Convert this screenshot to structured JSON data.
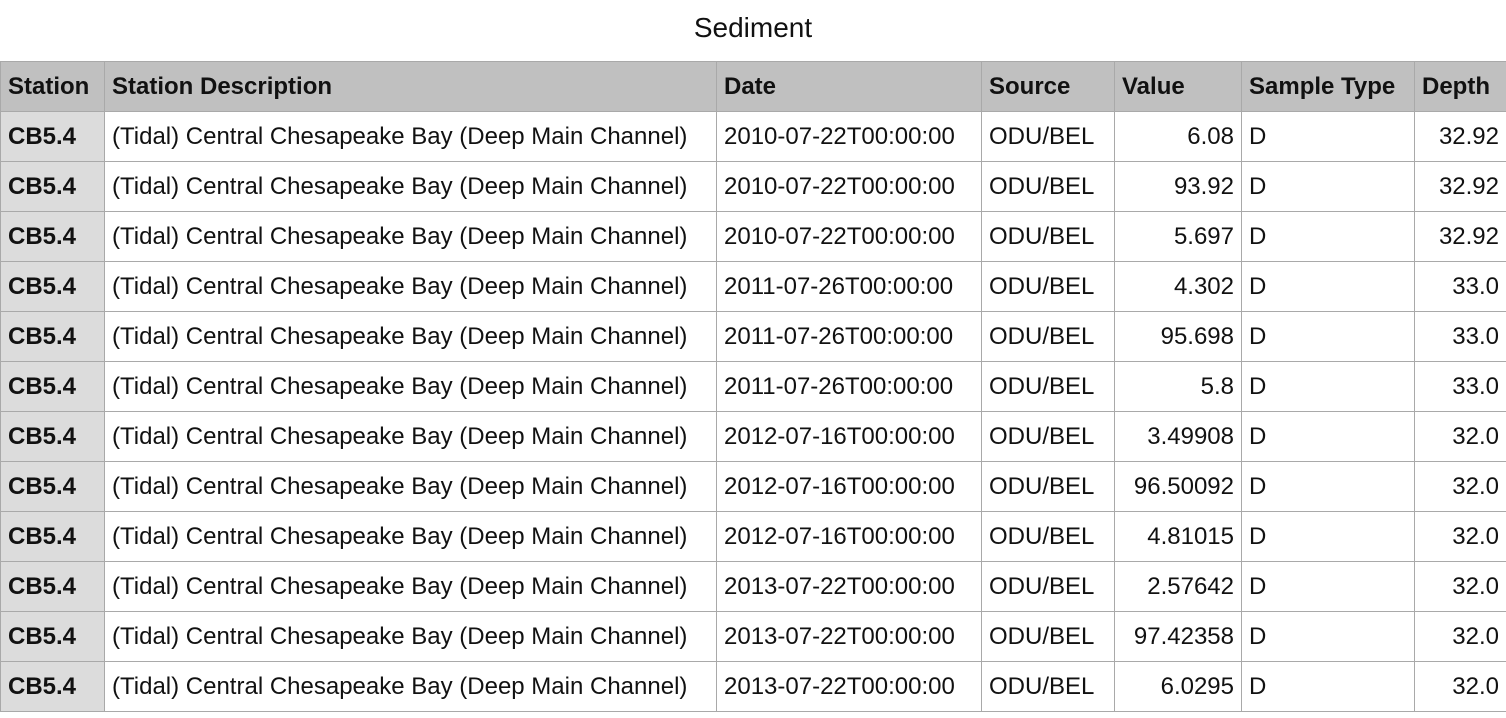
{
  "title": "Sediment",
  "columns": {
    "station": "Station",
    "description": "Station Description",
    "date": "Date",
    "source": "Source",
    "value": "Value",
    "sample_type": "Sample Type",
    "depth": "Depth"
  },
  "rows": [
    {
      "station": "CB5.4",
      "description": "(Tidal) Central Chesapeake Bay (Deep Main Channel)",
      "date": "2010-07-22T00:00:00",
      "source": "ODU/BEL",
      "value": "6.08",
      "sample_type": "D",
      "depth": "32.92"
    },
    {
      "station": "CB5.4",
      "description": "(Tidal) Central Chesapeake Bay (Deep Main Channel)",
      "date": "2010-07-22T00:00:00",
      "source": "ODU/BEL",
      "value": "93.92",
      "sample_type": "D",
      "depth": "32.92"
    },
    {
      "station": "CB5.4",
      "description": "(Tidal) Central Chesapeake Bay (Deep Main Channel)",
      "date": "2010-07-22T00:00:00",
      "source": "ODU/BEL",
      "value": "5.697",
      "sample_type": "D",
      "depth": "32.92"
    },
    {
      "station": "CB5.4",
      "description": "(Tidal) Central Chesapeake Bay (Deep Main Channel)",
      "date": "2011-07-26T00:00:00",
      "source": "ODU/BEL",
      "value": "4.302",
      "sample_type": "D",
      "depth": "33.0"
    },
    {
      "station": "CB5.4",
      "description": "(Tidal) Central Chesapeake Bay (Deep Main Channel)",
      "date": "2011-07-26T00:00:00",
      "source": "ODU/BEL",
      "value": "95.698",
      "sample_type": "D",
      "depth": "33.0"
    },
    {
      "station": "CB5.4",
      "description": "(Tidal) Central Chesapeake Bay (Deep Main Channel)",
      "date": "2011-07-26T00:00:00",
      "source": "ODU/BEL",
      "value": "5.8",
      "sample_type": "D",
      "depth": "33.0"
    },
    {
      "station": "CB5.4",
      "description": "(Tidal) Central Chesapeake Bay (Deep Main Channel)",
      "date": "2012-07-16T00:00:00",
      "source": "ODU/BEL",
      "value": "3.49908",
      "sample_type": "D",
      "depth": "32.0"
    },
    {
      "station": "CB5.4",
      "description": "(Tidal) Central Chesapeake Bay (Deep Main Channel)",
      "date": "2012-07-16T00:00:00",
      "source": "ODU/BEL",
      "value": "96.50092",
      "sample_type": "D",
      "depth": "32.0"
    },
    {
      "station": "CB5.4",
      "description": "(Tidal) Central Chesapeake Bay (Deep Main Channel)",
      "date": "2012-07-16T00:00:00",
      "source": "ODU/BEL",
      "value": "4.81015",
      "sample_type": "D",
      "depth": "32.0"
    },
    {
      "station": "CB5.4",
      "description": "(Tidal) Central Chesapeake Bay (Deep Main Channel)",
      "date": "2013-07-22T00:00:00",
      "source": "ODU/BEL",
      "value": "2.57642",
      "sample_type": "D",
      "depth": "32.0"
    },
    {
      "station": "CB5.4",
      "description": "(Tidal) Central Chesapeake Bay (Deep Main Channel)",
      "date": "2013-07-22T00:00:00",
      "source": "ODU/BEL",
      "value": "97.42358",
      "sample_type": "D",
      "depth": "32.0"
    },
    {
      "station": "CB5.4",
      "description": "(Tidal) Central Chesapeake Bay (Deep Main Channel)",
      "date": "2013-07-22T00:00:00",
      "source": "ODU/BEL",
      "value": "6.0295",
      "sample_type": "D",
      "depth": "32.0"
    }
  ]
}
